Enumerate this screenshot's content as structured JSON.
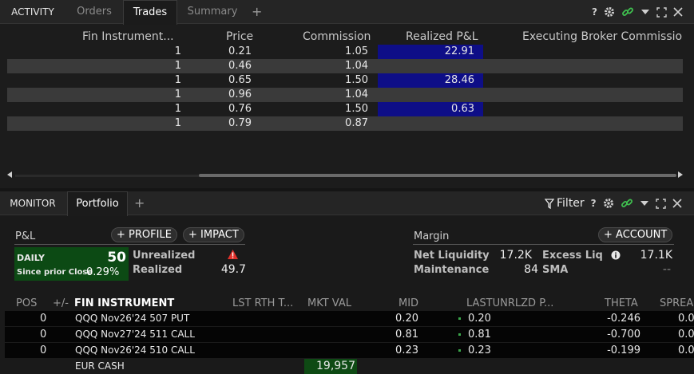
{
  "activity": {
    "title": "ACTIVITY",
    "tabs": [
      "Orders",
      "Trades",
      "Summary"
    ],
    "active_tab": "Trades",
    "headers": {
      "instrument": "Fin Instrument...",
      "price": "Price",
      "commission": "Commission",
      "realized": "Realized P&L",
      "exec": "Executing Broker Commissio"
    },
    "rows": [
      {
        "qty": "1",
        "price": "0.21",
        "commission": "1.05",
        "realized": "22.91"
      },
      {
        "qty": "1",
        "price": "0.46",
        "commission": "1.04",
        "realized": ""
      },
      {
        "qty": "1",
        "price": "0.65",
        "commission": "1.50",
        "realized": "28.46"
      },
      {
        "qty": "1",
        "price": "0.96",
        "commission": "1.04",
        "realized": ""
      },
      {
        "qty": "1",
        "price": "0.76",
        "commission": "1.50",
        "realized": "0.63"
      },
      {
        "qty": "1",
        "price": "0.79",
        "commission": "0.87",
        "realized": ""
      }
    ],
    "icons": [
      "help-icon",
      "gear-icon",
      "link-icon",
      "dropdown-icon",
      "maximize-icon",
      "close-icon"
    ]
  },
  "monitor": {
    "title": "MONITOR",
    "tabs": [
      "Portfolio"
    ],
    "active_tab": "Portfolio",
    "filter_label": "Filter",
    "pnl": {
      "title": "P&L",
      "profile_btn": "PROFILE",
      "impact_btn": "IMPACT",
      "daily_label": "DAILY",
      "daily_value": "50",
      "since_label": "Since prior Close",
      "since_value": "0.29%",
      "unrealized_label": "Unrealized",
      "realized_label": "Realized",
      "realized_value": "49.7"
    },
    "margin": {
      "title": "Margin",
      "account_btn": "ACCOUNT",
      "net_liq_label": "Net Liquidity",
      "net_liq_value": "17.2K",
      "excess_liq_label": "Excess Liq",
      "excess_liq_value": "17.1K",
      "maintenance_label": "Maintenance",
      "maintenance_value": "84",
      "sma_label": "SMA",
      "sma_value": "--"
    },
    "columns": {
      "pos": "POS",
      "plusminus": "+/-",
      "instrument": "FIN INSTRUMENT",
      "lst": "LST RTH T...",
      "mkt": "MKT VAL",
      "mid": "MID",
      "last": "LASTUNRLZD P...",
      "theta": "THETA",
      "spread": "SPREA"
    },
    "rows": [
      {
        "pos": "0",
        "instrument": "QQQ Nov26'24 507 PUT",
        "mid": "0.20",
        "last": "0.20",
        "theta": "-0.246",
        "spread": "0.0"
      },
      {
        "pos": "0",
        "instrument": "QQQ Nov27'24 511 CALL",
        "mid": "0.81",
        "last": "0.81",
        "theta": "-0.700",
        "spread": "0.0"
      },
      {
        "pos": "0",
        "instrument": "QQQ Nov26'24 510 CALL",
        "mid": "0.23",
        "last": "0.23",
        "theta": "-0.199",
        "spread": "0.0"
      }
    ],
    "cash": {
      "label": "EUR CASH",
      "value": "19,957"
    },
    "colors": {
      "daily_bg": "#0c4a14",
      "realized_hl": "#0e0e87",
      "cash_bg": "#0e4a14",
      "dot": "#3aa64a"
    }
  }
}
